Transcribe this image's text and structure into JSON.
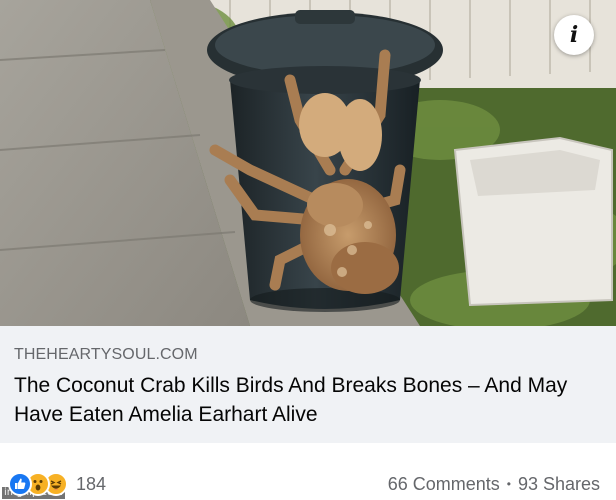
{
  "post": {
    "photo_alt": "",
    "info_badge_glyph": "i",
    "domain": "THEHEARTYSOUL.COM",
    "headline": "The Coconut Crab Kills Birds And Breaks Bones – And May Have Eaten Amelia Earhart Alive",
    "reaction_icons": [
      "like-icon",
      "wow-icon",
      "haha-icon"
    ],
    "reaction_count": "184",
    "comments": "66 Comments",
    "separator": "•",
    "shares": "93 Shares",
    "watermark": "imgflip.com"
  },
  "colors": {
    "link_box_bg": "#f0f2f5",
    "domain_text": "#65676b",
    "like_blue": "#1877f2",
    "emoji_yellow": "#f7b125"
  }
}
